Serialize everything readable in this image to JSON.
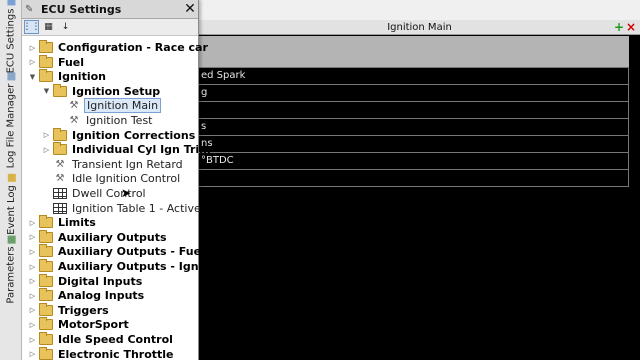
{
  "panel": {
    "title": "ECU Settings",
    "toolbar": [
      "categorized-icon",
      "table-view-icon",
      "sort-az-icon"
    ]
  },
  "side_tabs": [
    "ECU Settings",
    "Log File Manager",
    "Event Log",
    "Parameters"
  ],
  "main": {
    "title": "Ignition Main",
    "rows": [
      "ed Spark",
      "g",
      "",
      "s",
      "ns",
      "°BTDC",
      ""
    ]
  },
  "tree": [
    {
      "label": "Configuration - Race car",
      "level": 0,
      "icon": "folder",
      "bold": true,
      "expander": "collapsed"
    },
    {
      "label": "Fuel",
      "level": 0,
      "icon": "folder",
      "bold": true,
      "expander": "collapsed"
    },
    {
      "label": "Ignition",
      "level": 0,
      "icon": "folder",
      "bold": true,
      "expander": "expanded"
    },
    {
      "label": "Ignition Setup",
      "level": 1,
      "icon": "folder",
      "bold": true,
      "expander": "expanded"
    },
    {
      "label": "Ignition Main",
      "level": 2,
      "icon": "wrench",
      "bold": false,
      "expander": "",
      "selected": true
    },
    {
      "label": "Ignition Test",
      "level": 2,
      "icon": "wrench",
      "bold": false,
      "expander": ""
    },
    {
      "label": "Ignition Corrections",
      "level": 1,
      "icon": "folder",
      "bold": true,
      "expander": "collapsed"
    },
    {
      "label": "Individual Cyl Ign Trim",
      "level": 1,
      "icon": "folder",
      "bold": true,
      "expander": "collapsed"
    },
    {
      "label": "Transient Ign Retard",
      "level": 1,
      "icon": "wrench",
      "bold": false,
      "expander": ""
    },
    {
      "label": "Idle Ignition Control",
      "level": 1,
      "icon": "wrench",
      "bold": false,
      "expander": ""
    },
    {
      "label": "Dwell Control",
      "level": 1,
      "icon": "table",
      "bold": false,
      "expander": ""
    },
    {
      "label": "Ignition Table 1 - Active",
      "level": 1,
      "icon": "table",
      "bold": false,
      "expander": ""
    },
    {
      "label": "Limits",
      "level": 0,
      "icon": "folder",
      "bold": true,
      "expander": "collapsed"
    },
    {
      "label": "Auxiliary Outputs",
      "level": 0,
      "icon": "folder",
      "bold": true,
      "expander": "collapsed"
    },
    {
      "label": "Auxiliary Outputs - Fuel",
      "level": 0,
      "icon": "folder",
      "bold": true,
      "expander": "collapsed"
    },
    {
      "label": "Auxiliary Outputs - Ign",
      "level": 0,
      "icon": "folder",
      "bold": true,
      "expander": "collapsed"
    },
    {
      "label": "Digital Inputs",
      "level": 0,
      "icon": "folder",
      "bold": true,
      "expander": "collapsed"
    },
    {
      "label": "Analog Inputs",
      "level": 0,
      "icon": "folder",
      "bold": true,
      "expander": "collapsed"
    },
    {
      "label": "Triggers",
      "level": 0,
      "icon": "folder",
      "bold": true,
      "expander": "collapsed"
    },
    {
      "label": "MotorSport",
      "level": 0,
      "icon": "folder",
      "bold": true,
      "expander": "collapsed"
    },
    {
      "label": "Idle Speed Control",
      "level": 0,
      "icon": "folder",
      "bold": true,
      "expander": "collapsed"
    },
    {
      "label": "Electronic Throttle",
      "level": 0,
      "icon": "folder",
      "bold": true,
      "expander": "collapsed"
    }
  ]
}
